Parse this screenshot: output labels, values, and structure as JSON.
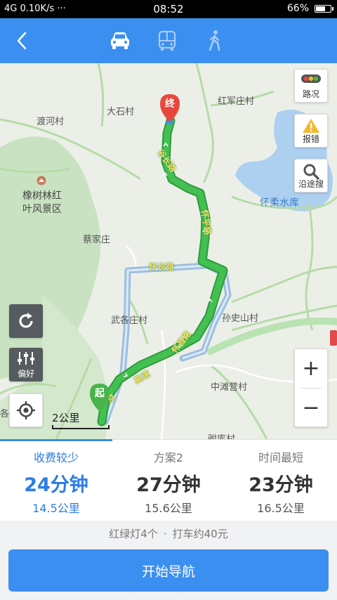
{
  "status_bar": {
    "network": "4G",
    "speed": "0.10K/s",
    "more": "···",
    "time": "08:52",
    "battery": "66%",
    "battery_level": 0.66
  },
  "header": {
    "back_icon": "chevron-left-icon",
    "modes": [
      {
        "name": "car",
        "icon": "car-icon",
        "selected": true
      },
      {
        "name": "bus",
        "icon": "bus-icon",
        "selected": false
      },
      {
        "name": "walk",
        "icon": "walk-icon",
        "selected": false
      }
    ]
  },
  "map": {
    "places": {
      "dushi": "大石村",
      "hongjun": "红军庄村",
      "duhe": "渡河村",
      "xiangshu": "橡树林红",
      "xiangshu2": "叶风景区",
      "caijia": "蔡家庄",
      "wuge": "武各庄村",
      "sunshi": "孙史山村",
      "zhongtan": "中滩营村",
      "huairou": "怀柔水库",
      "ge": "各",
      "bottom": "驸库村"
    },
    "roads": {
      "ganzhang": "谷长路",
      "huaiping": "怀平路",
      "huaizhang": "怀长路",
      "huaichang2": "怀昌路",
      "gaosu": "高速",
      "jing": "京"
    },
    "markers": {
      "end": "终",
      "start": "起"
    },
    "buttons": {
      "traffic": "路况",
      "report": "报错",
      "search": "沿途搜",
      "preference": "偏好"
    },
    "zoom_in": "+",
    "zoom_out": "−",
    "scale": "2公里"
  },
  "plans": [
    {
      "name": "收费较少",
      "time": "24分钟",
      "distance": "14.5公里",
      "active": true
    },
    {
      "name": "方案2",
      "time": "27分钟",
      "distance": "15.6公里",
      "active": false
    },
    {
      "name": "时间最短",
      "time": "23分钟",
      "distance": "16.5公里",
      "active": false
    }
  ],
  "info": {
    "lights": "红绿灯4个",
    "separator": "·",
    "taxi": "打车约40元"
  },
  "start_button": "开始导航",
  "colors": {
    "accent": "#3b8ff0",
    "route_green": "#3fb04a",
    "alt_route": "#9dbfe0",
    "end_marker": "#e8473c",
    "start_marker": "#47b34a"
  }
}
